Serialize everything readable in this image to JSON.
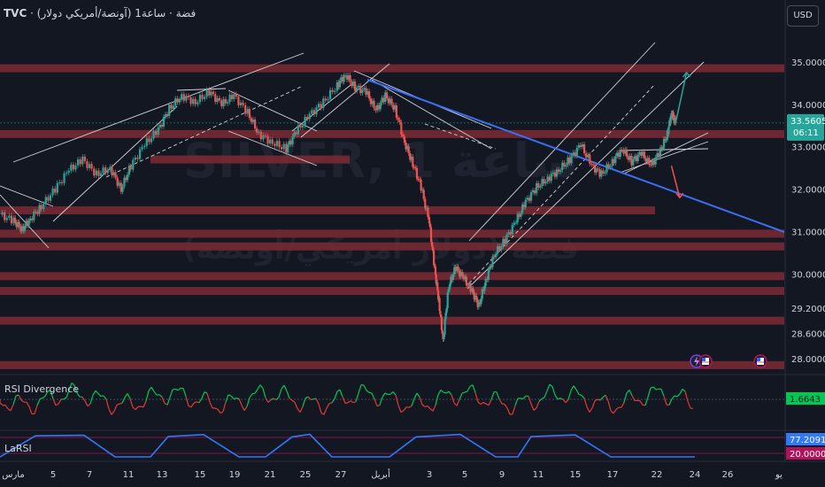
{
  "header": {
    "symbol": "TVC",
    "separator": "·",
    "title": "(آونصة/أمريكي دولار) فضة",
    "timeframe": "ساعة1",
    "currency": "USD"
  },
  "watermark": {
    "line1": "SILVER, 1 ساعة",
    "line2": "فضة (دولار أمريكي/أونصة)"
  },
  "chart_data": {
    "type": "line",
    "title": "",
    "ylabel": "",
    "ylim": [
      27.65,
      35.75
    ],
    "ticks_y": [
      "35.0000",
      "34.0000",
      "33.0000",
      "32.0000",
      "31.0000",
      "30.0000",
      "29.2000",
      "28.6000",
      "28.0000"
    ],
    "tick_values_y": [
      35,
      34,
      33,
      32,
      31,
      30,
      29.2,
      28.6,
      28
    ],
    "x_tick_labels": [
      "مارس",
      "5",
      "7",
      "11",
      "13",
      "15",
      "19",
      "21",
      "25",
      "27",
      "أبريل",
      "3",
      "5",
      "9",
      "11",
      "15",
      "17",
      "22",
      "24",
      "26",
      "يو"
    ],
    "last_price": "33.5605",
    "countdown": "06:11",
    "price_series": [
      {
        "t": 0,
        "v": 31.4
      },
      {
        "t": 1,
        "v": 31.25
      },
      {
        "t": 1.6,
        "v": 31.05
      },
      {
        "t": 2.2,
        "v": 31.3
      },
      {
        "t": 3,
        "v": 31.6
      },
      {
        "t": 4,
        "v": 32.0
      },
      {
        "t": 5,
        "v": 32.45
      },
      {
        "t": 6,
        "v": 32.7
      },
      {
        "t": 7,
        "v": 32.35
      },
      {
        "t": 8,
        "v": 32.5
      },
      {
        "t": 8.8,
        "v": 32.0
      },
      {
        "t": 9.5,
        "v": 32.55
      },
      {
        "t": 10.5,
        "v": 33.05
      },
      {
        "t": 11.5,
        "v": 33.4
      },
      {
        "t": 12.3,
        "v": 33.9
      },
      {
        "t": 13.2,
        "v": 34.2
      },
      {
        "t": 14.2,
        "v": 34.05
      },
      {
        "t": 15.2,
        "v": 34.3
      },
      {
        "t": 16.1,
        "v": 34.0
      },
      {
        "t": 17,
        "v": 34.2
      },
      {
        "t": 18,
        "v": 33.8
      },
      {
        "t": 18.8,
        "v": 33.3
      },
      {
        "t": 19.8,
        "v": 33.1
      },
      {
        "t": 20.8,
        "v": 32.95
      },
      {
        "t": 21.5,
        "v": 33.35
      },
      {
        "t": 22.5,
        "v": 33.75
      },
      {
        "t": 23.5,
        "v": 34.05
      },
      {
        "t": 24.5,
        "v": 34.45
      },
      {
        "t": 25.1,
        "v": 34.7
      },
      {
        "t": 25.8,
        "v": 34.4
      },
      {
        "t": 26.6,
        "v": 34.3
      },
      {
        "t": 27.3,
        "v": 33.85
      },
      {
        "t": 28,
        "v": 34.2
      },
      {
        "t": 28.7,
        "v": 33.9
      },
      {
        "t": 29.4,
        "v": 33.1
      },
      {
        "t": 30,
        "v": 32.6
      },
      {
        "t": 30.6,
        "v": 32.05
      },
      {
        "t": 31.2,
        "v": 31.2
      },
      {
        "t": 31.6,
        "v": 30.1
      },
      {
        "t": 31.9,
        "v": 29.35
      },
      {
        "t": 32.2,
        "v": 28.45
      },
      {
        "t": 32.6,
        "v": 29.7
      },
      {
        "t": 33.1,
        "v": 30.15
      },
      {
        "t": 33.7,
        "v": 29.9
      },
      {
        "t": 34.3,
        "v": 29.6
      },
      {
        "t": 34.8,
        "v": 29.25
      },
      {
        "t": 35.3,
        "v": 29.85
      },
      {
        "t": 35.9,
        "v": 30.45
      },
      {
        "t": 36.7,
        "v": 30.8
      },
      {
        "t": 37.5,
        "v": 31.25
      },
      {
        "t": 38.2,
        "v": 31.7
      },
      {
        "t": 39,
        "v": 32.05
      },
      {
        "t": 39.8,
        "v": 32.25
      },
      {
        "t": 40.6,
        "v": 32.45
      },
      {
        "t": 41.4,
        "v": 32.7
      },
      {
        "t": 42.2,
        "v": 33.05
      },
      {
        "t": 43,
        "v": 32.55
      },
      {
        "t": 43.7,
        "v": 32.35
      },
      {
        "t": 44.5,
        "v": 32.65
      },
      {
        "t": 45.2,
        "v": 32.95
      },
      {
        "t": 45.9,
        "v": 32.65
      },
      {
        "t": 46.6,
        "v": 32.85
      },
      {
        "t": 47.3,
        "v": 32.55
      },
      {
        "t": 48,
        "v": 32.9
      },
      {
        "t": 48.5,
        "v": 33.3
      },
      {
        "t": 48.8,
        "v": 33.8
      },
      {
        "t": 49.1,
        "v": 33.56
      }
    ],
    "x_range": [
      0,
      57
    ],
    "resistance_zones": [
      34.85,
      33.3,
      32.7,
      31.5,
      30.95,
      30.65,
      29.95,
      29.6,
      28.9,
      27.85
    ],
    "annotations": {
      "projection_up": [
        [
          49.1,
          33.56
        ],
        [
          49.9,
          34.75
        ]
      ],
      "projection_down": [
        [
          48.8,
          32.55
        ],
        [
          49.4,
          31.8
        ]
      ]
    }
  },
  "indicators": [
    {
      "name": "RSI Divergence",
      "value": "1.6643",
      "color": "#00c853"
    },
    {
      "name": "LaRSI",
      "value_main": "77.2091",
      "value_secondary": "20.0000",
      "color": "#3179f5",
      "color_secondary": "#b2125b"
    }
  ],
  "colors": {
    "background": "#131722",
    "zone": "#7d2a34",
    "up": "#26a69a",
    "down": "#ef5350",
    "trendline": "#3b6ff2",
    "channel": "#d1d4dc"
  },
  "markers": [
    {
      "icon": "lightning-icon",
      "label": ""
    },
    {
      "icon": "us-flag-icon",
      "label": ""
    },
    {
      "icon": "us-flag-icon",
      "label": ""
    }
  ]
}
